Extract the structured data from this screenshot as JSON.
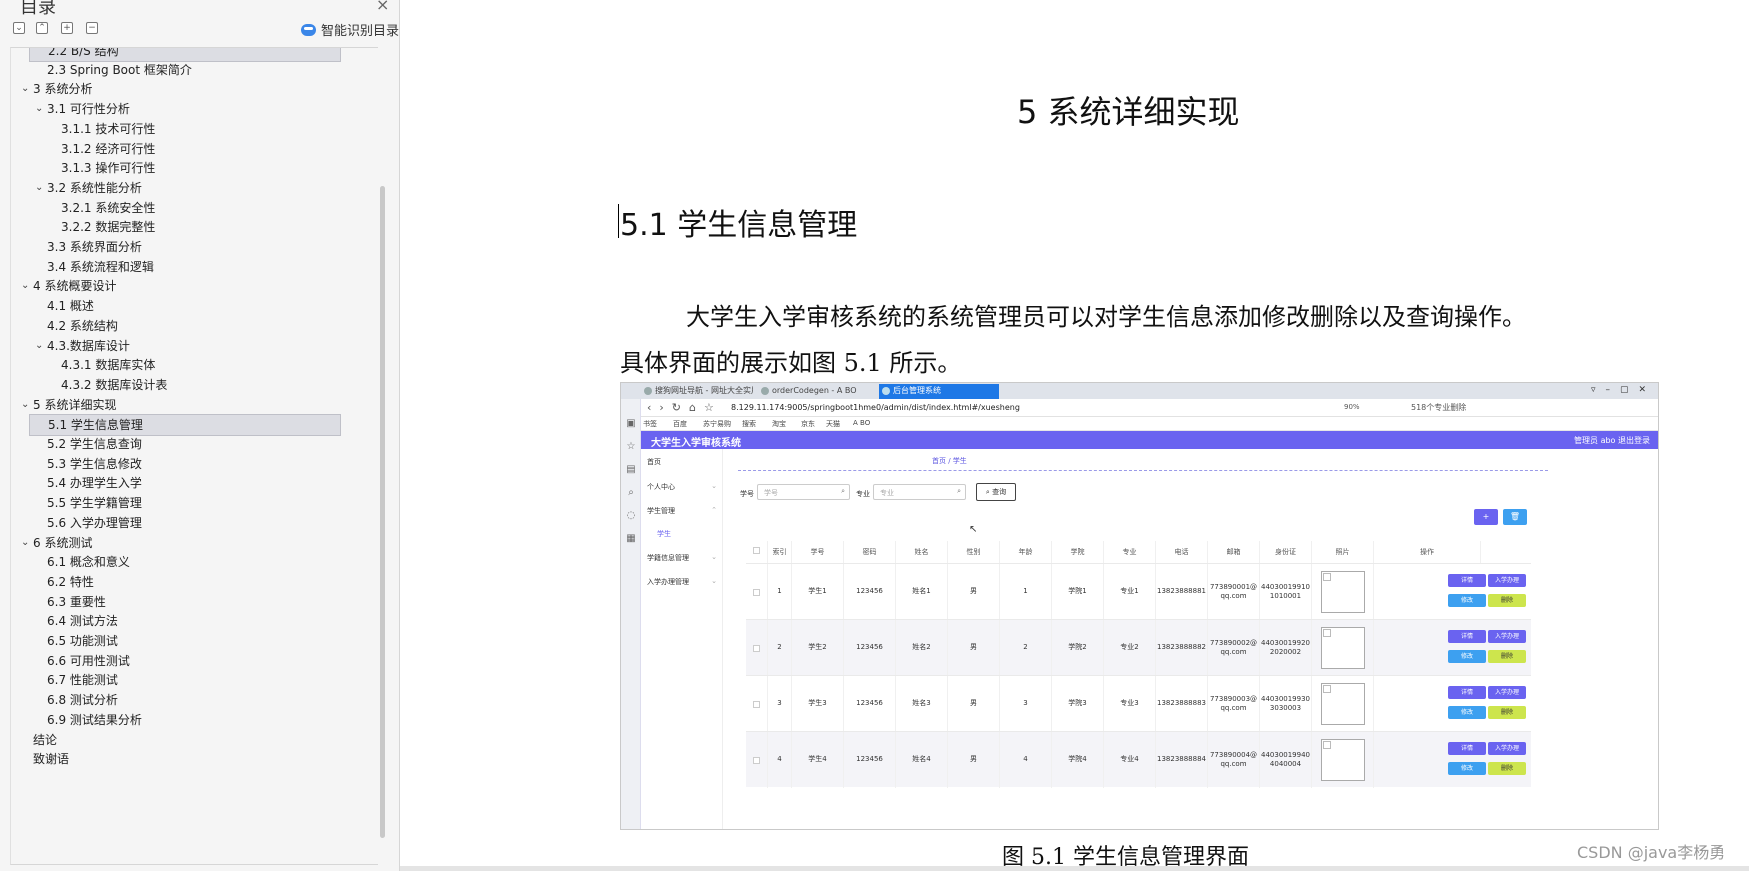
{
  "sidebar": {
    "title": "目录",
    "close": "×",
    "smart_label": "智能识别目录",
    "toc": [
      {
        "text": "2.2 B/S 结构",
        "level": 2,
        "expanded": null,
        "selected": true
      },
      {
        "text": "2.3 Spring Boot 框架简介",
        "level": 2,
        "expanded": null,
        "selected": false
      },
      {
        "text": "3 系统分析",
        "level": 1,
        "expanded": true,
        "selected": false
      },
      {
        "text": "3.1 可行性分析",
        "level": 2,
        "expanded": true,
        "selected": false
      },
      {
        "text": "3.1.1 技术可行性",
        "level": 3,
        "expanded": null,
        "selected": false
      },
      {
        "text": "3.1.2 经济可行性",
        "level": 3,
        "expanded": null,
        "selected": false
      },
      {
        "text": "3.1.3 操作可行性",
        "level": 3,
        "expanded": null,
        "selected": false
      },
      {
        "text": "3.2 系统性能分析",
        "level": 2,
        "expanded": true,
        "selected": false
      },
      {
        "text": "3.2.1 系统安全性",
        "level": 3,
        "expanded": null,
        "selected": false
      },
      {
        "text": "3.2.2 数据完整性",
        "level": 3,
        "expanded": null,
        "selected": false
      },
      {
        "text": "3.3 系统界面分析",
        "level": 2,
        "expanded": null,
        "selected": false
      },
      {
        "text": "3.4 系统流程和逻辑",
        "level": 2,
        "expanded": null,
        "selected": false
      },
      {
        "text": "4 系统概要设计",
        "level": 1,
        "expanded": true,
        "selected": false
      },
      {
        "text": "4.1 概述",
        "level": 2,
        "expanded": null,
        "selected": false
      },
      {
        "text": "4.2 系统结构",
        "level": 2,
        "expanded": null,
        "selected": false
      },
      {
        "text": "4.3.数据库设计",
        "level": 2,
        "expanded": true,
        "selected": false
      },
      {
        "text": "4.3.1 数据库实体",
        "level": 3,
        "expanded": null,
        "selected": false
      },
      {
        "text": "4.3.2 数据库设计表",
        "level": 3,
        "expanded": null,
        "selected": false
      },
      {
        "text": "5 系统详细实现",
        "level": 1,
        "expanded": true,
        "selected": false
      },
      {
        "text": "5.1 学生信息管理",
        "level": 2,
        "expanded": null,
        "selected": true
      },
      {
        "text": "5.2 学生信息查询",
        "level": 2,
        "expanded": null,
        "selected": false
      },
      {
        "text": "5.3 学生信息修改",
        "level": 2,
        "expanded": null,
        "selected": false
      },
      {
        "text": "5.4 办理学生入学",
        "level": 2,
        "expanded": null,
        "selected": false
      },
      {
        "text": "5.5 学生学籍管理",
        "level": 2,
        "expanded": null,
        "selected": false
      },
      {
        "text": "5.6 入学办理管理",
        "level": 2,
        "expanded": null,
        "selected": false
      },
      {
        "text": "6 系统测试",
        "level": 1,
        "expanded": true,
        "selected": false
      },
      {
        "text": "6.1 概念和意义",
        "level": 2,
        "expanded": null,
        "selected": false
      },
      {
        "text": "6.2 特性",
        "level": 2,
        "expanded": null,
        "selected": false
      },
      {
        "text": "6.3 重要性",
        "level": 2,
        "expanded": null,
        "selected": false
      },
      {
        "text": "6.4 测试方法",
        "level": 2,
        "expanded": null,
        "selected": false
      },
      {
        "text": "6.5 功能测试",
        "level": 2,
        "expanded": null,
        "selected": false
      },
      {
        "text": "6.6 可用性测试",
        "level": 2,
        "expanded": null,
        "selected": false
      },
      {
        "text": "6.7 性能测试",
        "level": 2,
        "expanded": null,
        "selected": false
      },
      {
        "text": "6.8 测试分析",
        "level": 2,
        "expanded": null,
        "selected": false
      },
      {
        "text": "6.9 测试结果分析",
        "level": 2,
        "expanded": null,
        "selected": false
      },
      {
        "text": "结论",
        "level": 1,
        "expanded": null,
        "selected": false
      },
      {
        "text": "致谢语",
        "level": 1,
        "expanded": null,
        "selected": false
      }
    ]
  },
  "document": {
    "chapter_title": "5 系统详细实现",
    "section_title": "5.1  学生信息管理",
    "paragraph_line1": "大学生入学审核系统的系统管理员可以对学生信息添加修改删除以及查询操作。",
    "paragraph_line2": "具体界面的展示如图 5.1 所示。",
    "caption": "图 5.1  学生信息管理界面",
    "watermark": "CSDN @java李杨勇"
  },
  "screenshot": {
    "tabs": [
      "搜狗网址导航 - 网址大全实用网址",
      "orderCodegen - A BO",
      "后台管理系统"
    ],
    "url": "8.129.11.174:9005/springboot1hme0/admin/dist/index.html#/xuesheng",
    "zoom": "90%",
    "ext_text": "518个专业删除",
    "bookmarks": [
      "书签",
      "百度",
      "苏宁易购",
      "搜索",
      "淘宝",
      "京东",
      "天猫",
      "A BO"
    ],
    "app_title": "大学生入学审核系统",
    "user_text": "管理员 abo   退出登录",
    "menu": [
      {
        "label": "首页",
        "arrow": ""
      },
      {
        "label": "个人中心",
        "arrow": "⌄"
      },
      {
        "label": "学生管理",
        "arrow": "⌃"
      },
      {
        "label": "学生",
        "arrow": ""
      },
      {
        "label": "学籍信息管理",
        "arrow": "⌄"
      },
      {
        "label": "入学办理管理",
        "arrow": "⌄"
      }
    ],
    "breadcrumb": "首页  /  学生",
    "filter": {
      "xuehao_label": "学号",
      "xuehao_placeholder": "学号",
      "zhuanye_label": "专业",
      "zhuanye_placeholder": "专业",
      "query_button": "查询"
    },
    "add_button": "+",
    "delete_button": "🗑",
    "columns": [
      "",
      "索引",
      "学号",
      "密码",
      "姓名",
      "性别",
      "年龄",
      "学院",
      "专业",
      "电话",
      "邮箱",
      "身份证",
      "照片",
      "操作"
    ],
    "rows": [
      {
        "idx": "1",
        "xuehao": "学生1",
        "mima": "123456",
        "xingming": "姓名1",
        "xingbie": "男",
        "nianling": "1",
        "xueyuan": "学院1",
        "zhuanye": "专业1",
        "dianhua": "13823888881",
        "email": "773890001@qq.com",
        "sfz": "440300199101010001"
      },
      {
        "idx": "2",
        "xuehao": "学生2",
        "mima": "123456",
        "xingming": "姓名2",
        "xingbie": "男",
        "nianling": "2",
        "xueyuan": "学院2",
        "zhuanye": "专业2",
        "dianhua": "13823888882",
        "email": "773890002@qq.com",
        "sfz": "440300199202020002"
      },
      {
        "idx": "3",
        "xuehao": "学生3",
        "mima": "123456",
        "xingming": "姓名3",
        "xingbie": "男",
        "nianling": "3",
        "xueyuan": "学院3",
        "zhuanye": "专业3",
        "dianhua": "13823888883",
        "email": "773890003@qq.com",
        "sfz": "440300199303030003"
      },
      {
        "idx": "4",
        "xuehao": "学生4",
        "mima": "123456",
        "xingming": "姓名4",
        "xingbie": "男",
        "nianling": "4",
        "xueyuan": "学院4",
        "zhuanye": "专业4",
        "dianhua": "13823888884",
        "email": "773890004@qq.com",
        "sfz": "440300199404040004"
      }
    ],
    "ops": {
      "detail": "详情",
      "enroll": "入学办理",
      "edit": "修改",
      "remove": "删除"
    }
  },
  "colors": {
    "app_header": "#6a63f0",
    "active_tab": "#1e78e6",
    "op_blue": "#6a63f0",
    "op_cyan": "#3da0f0",
    "op_lime": "#cde54d"
  }
}
